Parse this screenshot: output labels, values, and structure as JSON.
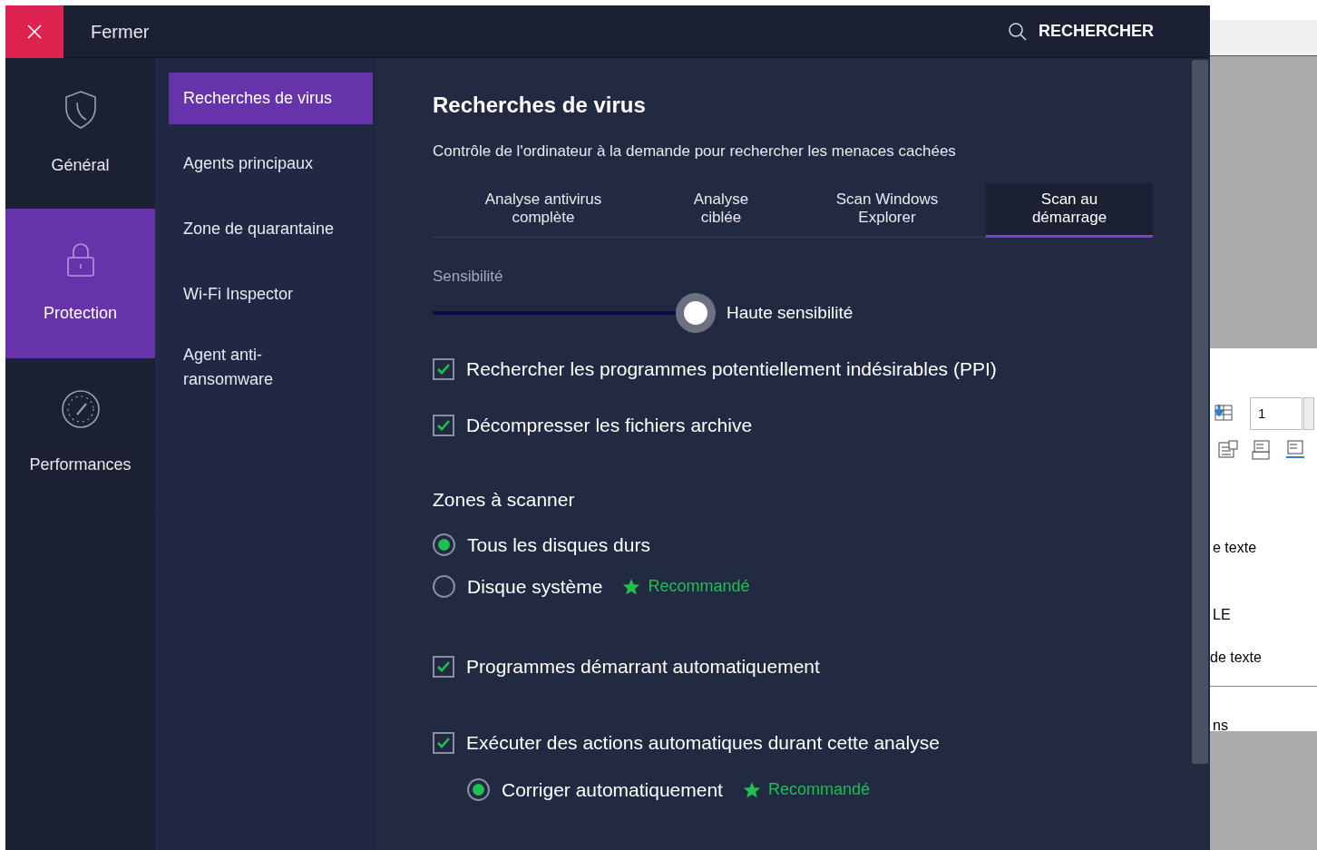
{
  "header": {
    "close_label": "Fermer",
    "search_label": "RECHERCHER"
  },
  "nav": [
    {
      "label": "Général",
      "selected": false
    },
    {
      "label": "Protection",
      "selected": true
    },
    {
      "label": "Performances",
      "selected": false
    }
  ],
  "submenu": [
    {
      "label": "Recherches de virus",
      "selected": true
    },
    {
      "label": "Agents principaux",
      "selected": false
    },
    {
      "label": "Zone de quarantaine",
      "selected": false
    },
    {
      "label": "Wi-Fi Inspector",
      "selected": false
    },
    {
      "label": "Agent anti-ransomware",
      "selected": false
    }
  ],
  "content": {
    "title": "Recherches de virus",
    "subtitle": "Contrôle de l'ordinateur à la demande pour rechercher les menaces cachées",
    "tabs": [
      {
        "label": "Analyse antivirus complète",
        "selected": false
      },
      {
        "label": "Analyse ciblée",
        "selected": false
      },
      {
        "label": "Scan Windows Explorer",
        "selected": false
      },
      {
        "label": "Scan au démarrage",
        "selected": true
      }
    ],
    "sensitivity": {
      "label": "Sensibilité",
      "level": 1,
      "reading": "Haute sensibilité"
    },
    "options": [
      {
        "kind": "checkbox",
        "label": "Rechercher les programmes potentiellement indésirables (PPI)",
        "checked": true
      },
      {
        "kind": "checkbox",
        "label": "Décompresser les fichiers archive",
        "checked": true
      },
      {
        "kind": "heading",
        "label": "Zones à scanner"
      },
      {
        "kind": "radio",
        "label": "Tous les disques durs",
        "checked": true
      },
      {
        "kind": "radio",
        "label": "Disque système",
        "checked": false,
        "badge": "Recommandé"
      },
      {
        "kind": "checkbox",
        "label": "Programmes démarrant automatiquement",
        "checked": true
      },
      {
        "kind": "checkbox",
        "label": "Exécuter des actions automatiques durant cette analyse",
        "checked": true,
        "children": [
          {
            "kind": "radio",
            "label": "Corriger automatiquement",
            "checked": true,
            "badge": "Recommandé"
          }
        ]
      }
    ]
  },
  "background_window": {
    "spin_value": "1",
    "texts": [
      "e texte",
      "LE",
      "de texte",
      "ns"
    ]
  }
}
